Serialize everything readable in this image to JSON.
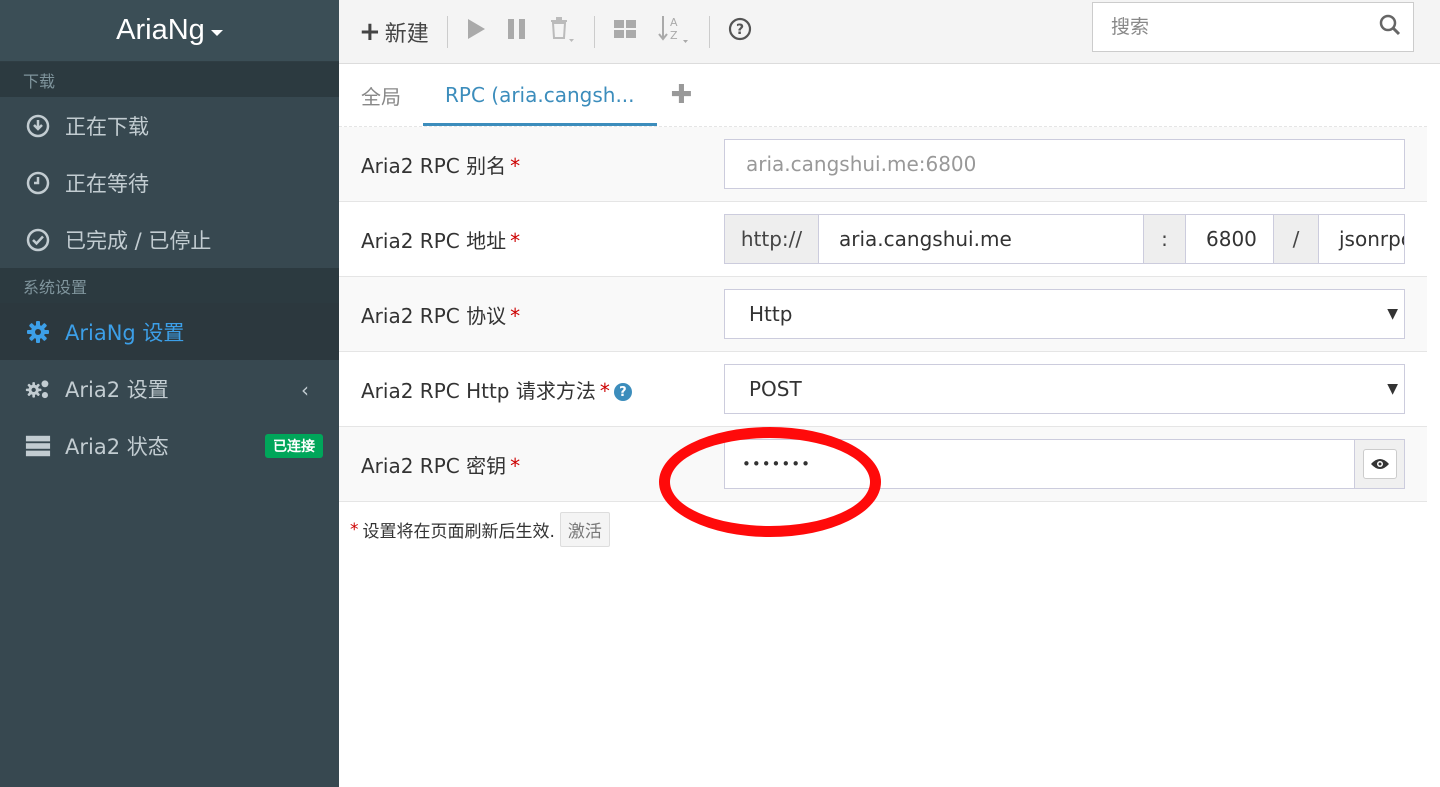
{
  "app": {
    "brand": "AriaNg"
  },
  "sidebar": {
    "download_header": "下载",
    "download_items": [
      {
        "label": "正在下载",
        "icon": "download-circle-icon"
      },
      {
        "label": "正在等待",
        "icon": "clock-icon"
      },
      {
        "label": "已完成 / 已停止",
        "icon": "check-circle-icon"
      }
    ],
    "settings_header": "系统设置",
    "settings_items": [
      {
        "label": "AriaNg 设置",
        "icon": "gear-icon",
        "active": true
      },
      {
        "label": "Aria2 设置",
        "icon": "gears-icon"
      },
      {
        "label": "Aria2 状态",
        "icon": "server-icon",
        "badge": "已连接"
      }
    ]
  },
  "toolbar": {
    "new_label": "新建",
    "search_placeholder": "搜索"
  },
  "tabs": [
    {
      "label": "全局",
      "active": false
    },
    {
      "label": "RPC (aria.cangsh...",
      "active": true
    }
  ],
  "form": {
    "alias": {
      "label": "Aria2 RPC 别名",
      "placeholder": "aria.cangshui.me:6800"
    },
    "address": {
      "label": "Aria2 RPC 地址",
      "protocol": "http://",
      "host": "aria.cangshui.me",
      "colon": ":",
      "port": "6800",
      "slash": "/",
      "path": "jsonrpc"
    },
    "protocol": {
      "label": "Aria2 RPC 协议",
      "value": "Http"
    },
    "method": {
      "label": "Aria2 RPC Http 请求方法",
      "value": "POST"
    },
    "secret": {
      "label": "Aria2 RPC 密钥",
      "value": "•••••••"
    },
    "required_mark": "*"
  },
  "footnote": {
    "text": "设置将在页面刷新后生效.",
    "button": "激活"
  },
  "colors": {
    "accent": "#3c8dbc",
    "sidebar_bg": "#374850",
    "badge": "#00a65a",
    "annotation": "#ff0a0a"
  }
}
